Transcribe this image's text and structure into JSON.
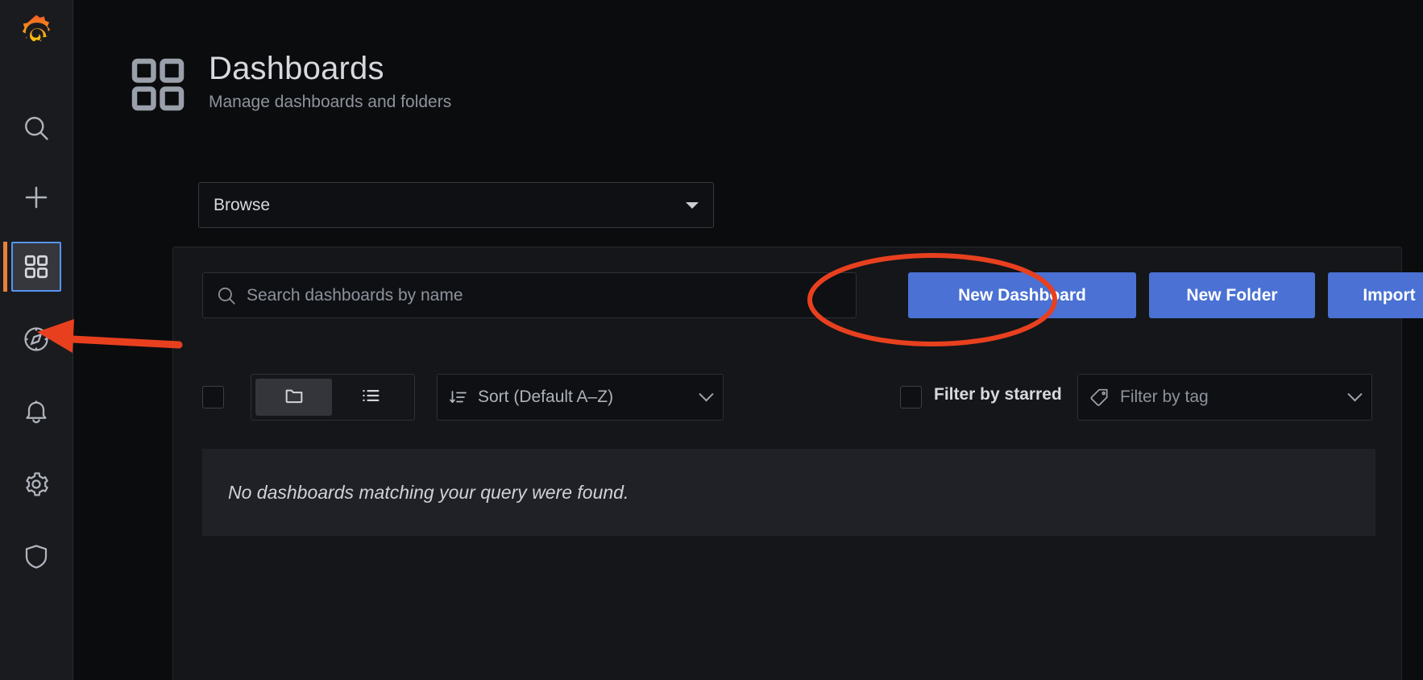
{
  "sidebar": {
    "logo_icon": "grafana-logo-icon",
    "items": [
      {
        "icon": "search-icon",
        "name": "search"
      },
      {
        "icon": "plus-icon",
        "name": "create"
      },
      {
        "icon": "apps-grid-icon",
        "name": "dashboards",
        "active": true
      },
      {
        "icon": "compass-icon",
        "name": "explore"
      },
      {
        "icon": "bell-icon",
        "name": "alerting"
      },
      {
        "icon": "gear-icon",
        "name": "configuration"
      },
      {
        "icon": "shield-icon",
        "name": "server-admin"
      }
    ]
  },
  "header": {
    "icon": "apps-grid-icon",
    "title": "Dashboards",
    "subtitle": "Manage dashboards and folders"
  },
  "browse_select": {
    "value": "Browse",
    "icon": "caret-down-icon"
  },
  "search": {
    "icon": "search-icon",
    "placeholder": "Search dashboards by name",
    "value": ""
  },
  "actions": {
    "new_dashboard": "New Dashboard",
    "new_folder": "New Folder",
    "import": "Import",
    "button_color": "#4a71d3"
  },
  "toolbar": {
    "select_all_checked": false,
    "view_folder_icon": "folder-icon",
    "view_list_icon": "list-icon",
    "view_active": "folder",
    "sort": {
      "icon": "sort-amount-down-icon",
      "value": "Sort (Default A–Z)",
      "chevron": "chevron-down-icon"
    },
    "filter_starred": {
      "label": "Filter by starred",
      "checked": false
    },
    "filter_tag": {
      "icon": "tag-icon",
      "placeholder": "Filter by tag",
      "chevron": "chevron-down-icon"
    }
  },
  "empty_state": {
    "message": "No dashboards matching your query were found."
  },
  "annotations": {
    "ellipse_color": "#e8401f",
    "arrow_color": "#e8401f",
    "highlight_border_color": "#5794f2",
    "accent_bar_color": "#e8813a"
  }
}
